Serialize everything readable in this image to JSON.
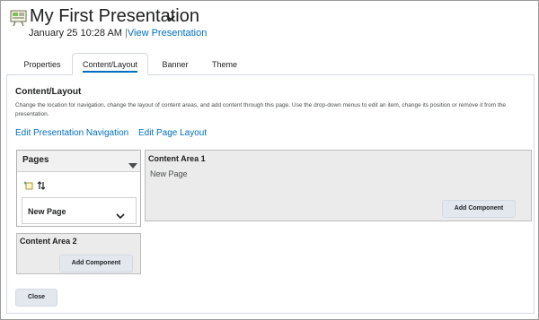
{
  "header": {
    "title": "My First Presentation",
    "date": "January 25 10:28 AM",
    "separator": "|",
    "view_link": "View Presentation"
  },
  "tabs": [
    {
      "label": "Properties"
    },
    {
      "label": "Content/Layout",
      "active": true
    },
    {
      "label": "Banner"
    },
    {
      "label": "Theme"
    }
  ],
  "main": {
    "heading": "Content/Layout",
    "description": "Change the location for navigation, change the layout of content areas, and add content through this page. Use the drop-down menus to edit an item, change its position or remove it from the presentation.",
    "links": {
      "edit_navigation": "Edit Presentation Navigation",
      "edit_layout": "Edit Page Layout"
    },
    "pages_panel": {
      "title": "Pages",
      "add_icon": "add-page-icon",
      "sort_icon": "reorder-icon",
      "item": "New Page"
    },
    "content_area_1": {
      "title": "Content Area 1",
      "page": "New Page",
      "add_button": "Add Component"
    },
    "content_area_2": {
      "title": "Content Area 2",
      "add_button": "Add Component"
    },
    "close_button": "Close"
  },
  "colors": {
    "link": "#006fbf",
    "area_bg": "#ebebeb",
    "button_bg": "#e3e8ef"
  }
}
